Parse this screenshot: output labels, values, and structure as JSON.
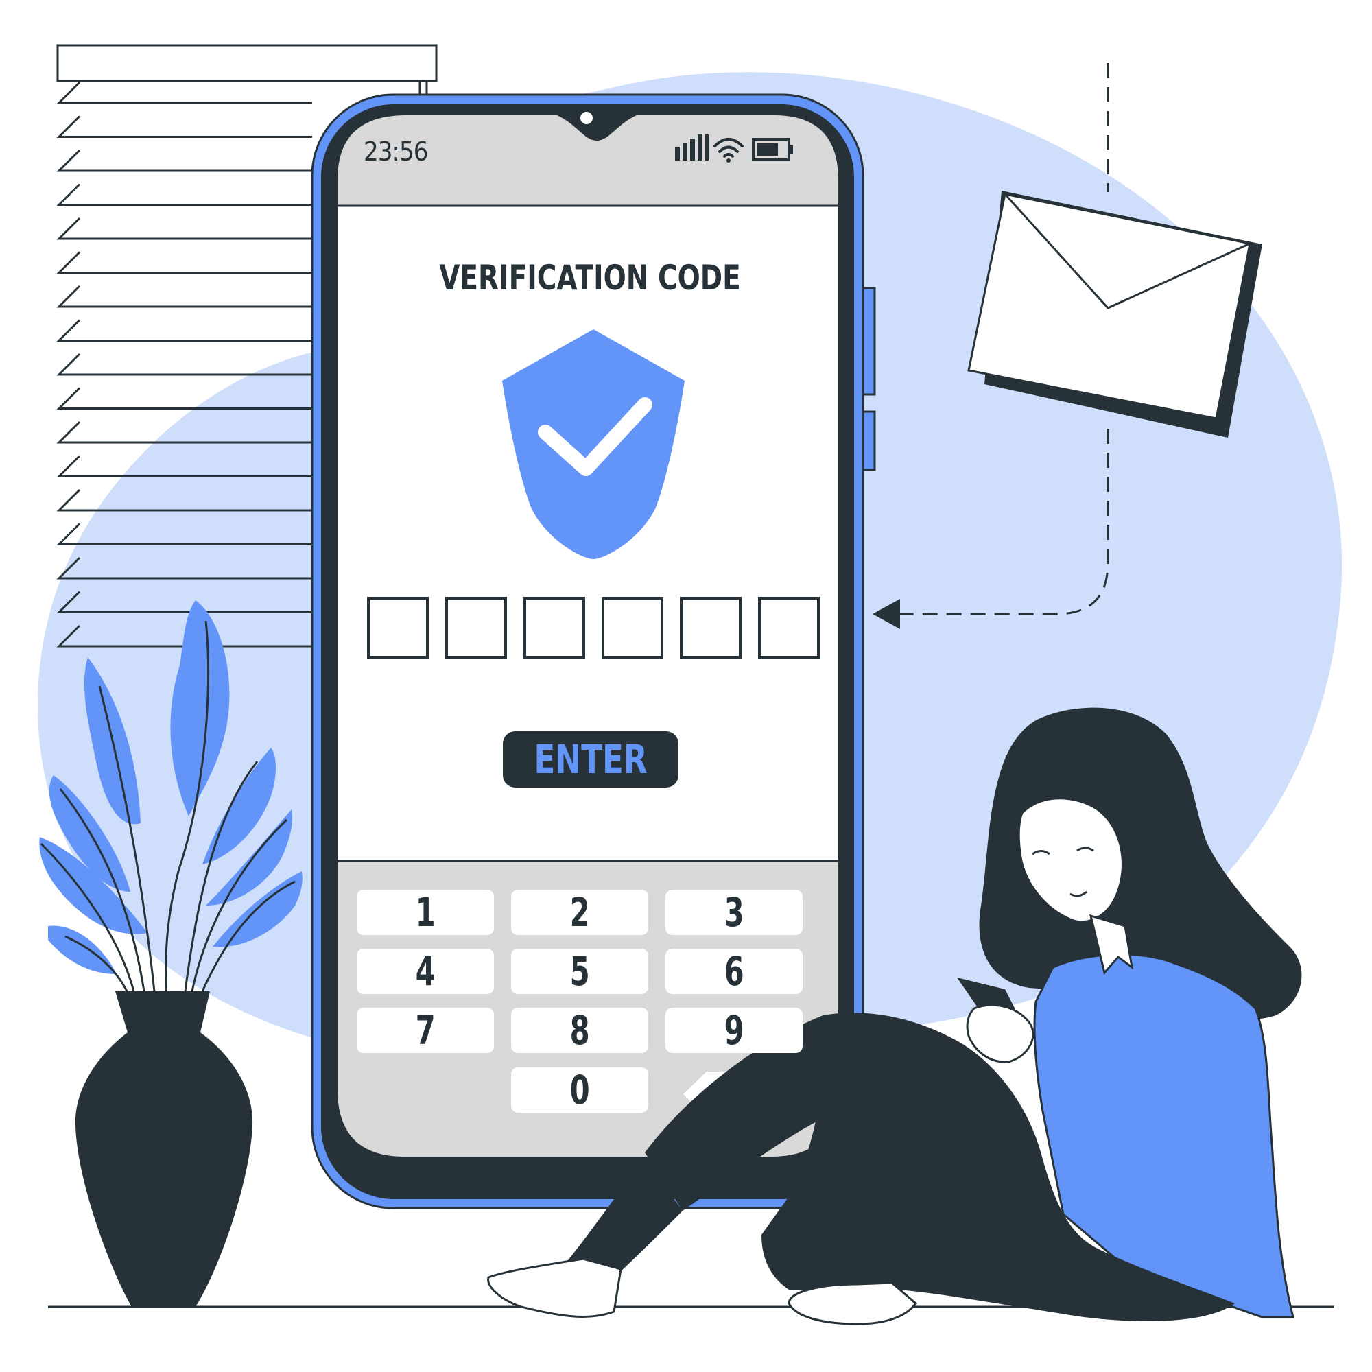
{
  "status_bar": {
    "time": "23:56",
    "signal_icon": "signal-bars-icon",
    "wifi_icon": "wifi-icon",
    "battery_icon": "battery-icon"
  },
  "screen": {
    "title": "VERIFICATION CODE",
    "shield_icon": "shield-check-icon",
    "code_boxes": [
      "",
      "",
      "",
      "",
      "",
      ""
    ],
    "enter_label": "ENTER"
  },
  "keypad": {
    "keys": [
      "1",
      "2",
      "3",
      "4",
      "5",
      "6",
      "7",
      "8",
      "9",
      "0"
    ],
    "backspace_icon": "backspace-icon"
  },
  "colors": {
    "accent": "#6394f8",
    "dark": "#263238",
    "background_blob": "#cfdefa",
    "screen_gray": "#d9d9d9"
  }
}
